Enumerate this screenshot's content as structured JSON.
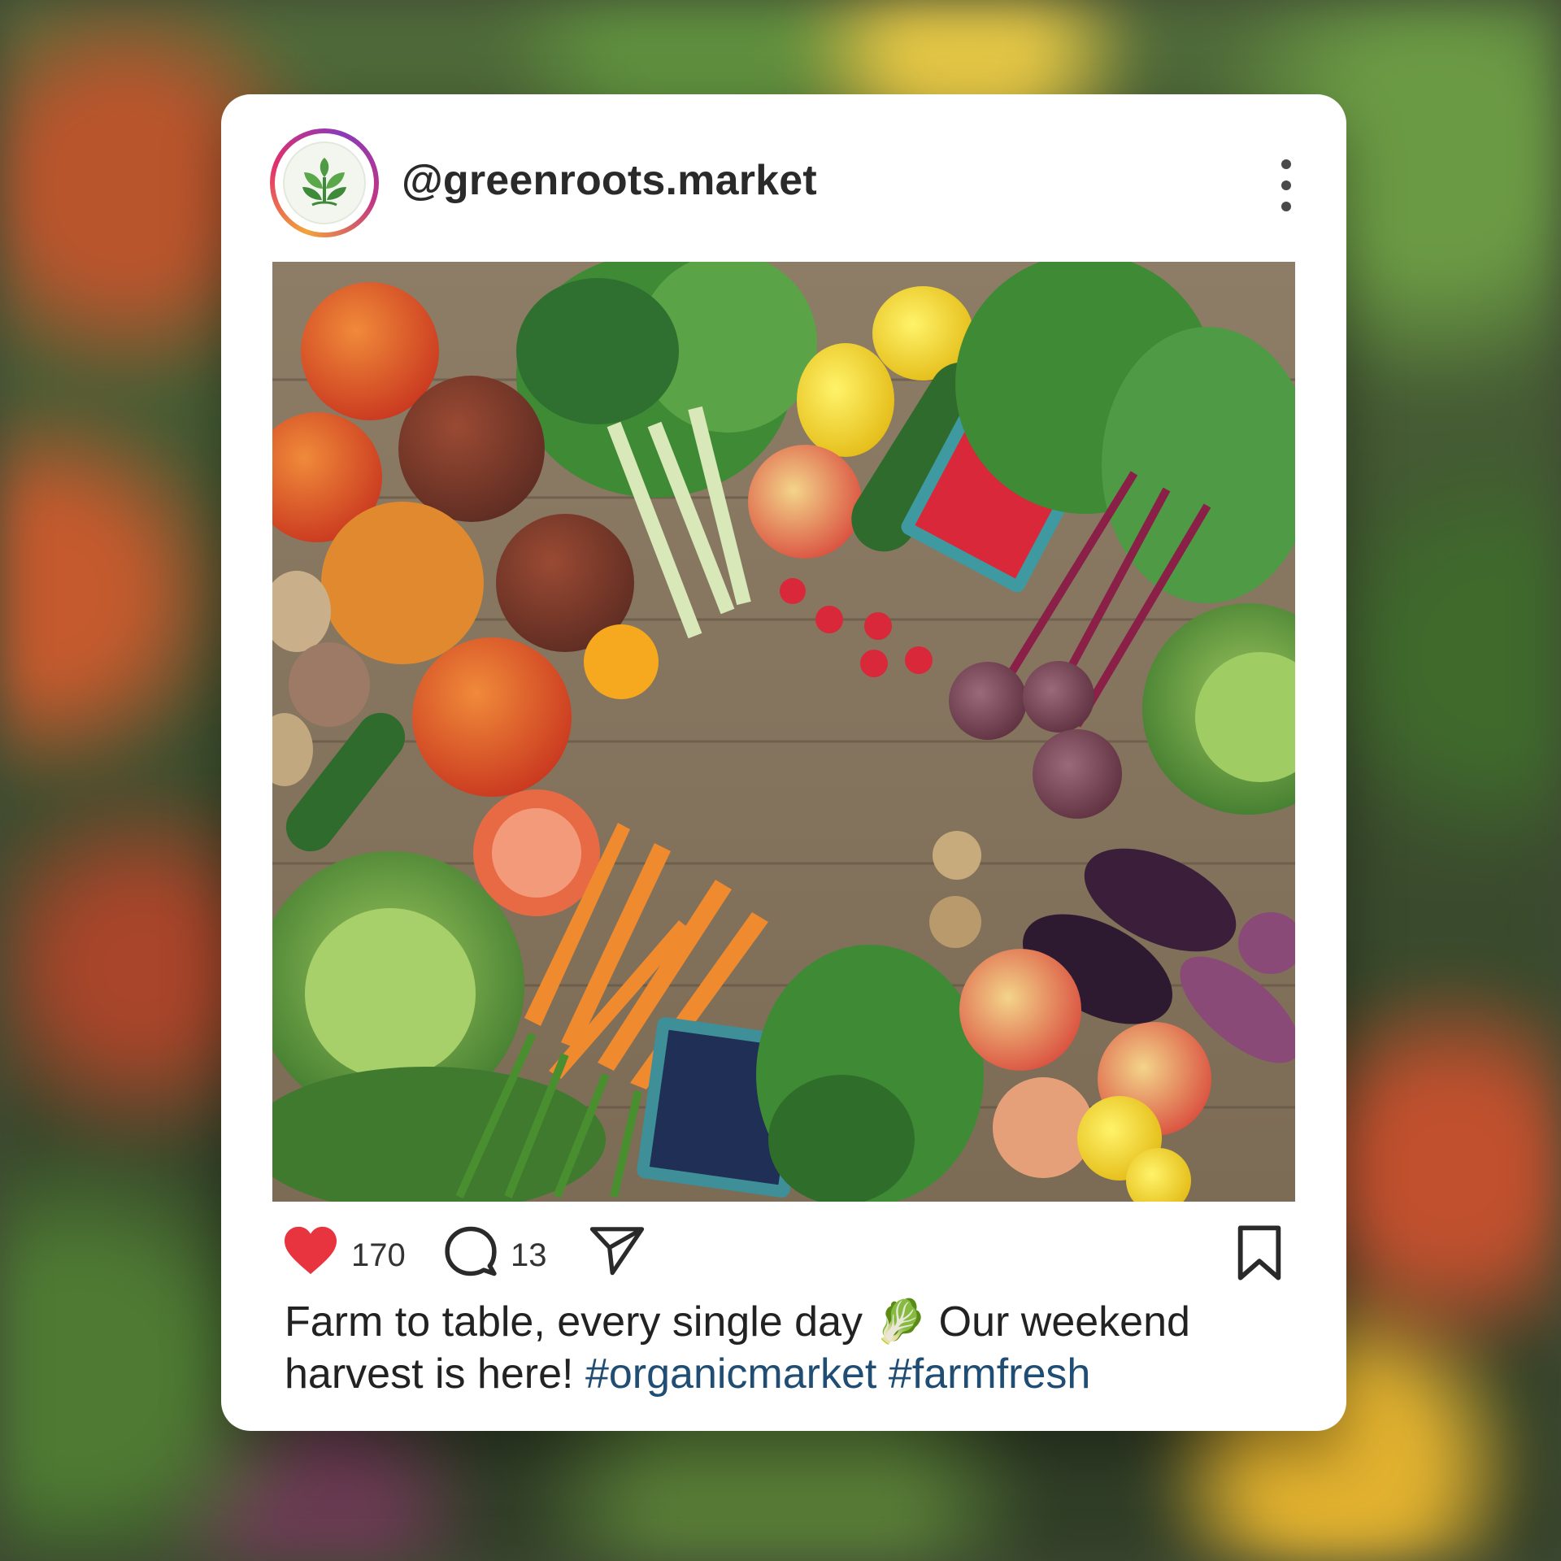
{
  "post": {
    "username": "@greenroots.market",
    "likes": "170",
    "comments": "13",
    "caption_text_1": "Farm to table, every single day ",
    "caption_emoji": "🥬",
    "caption_text_2": " Our weekend harvest is here! ",
    "hashtags": [
      "#organicmarket",
      "#farmfresh"
    ]
  },
  "icons": {
    "avatar": "sprout-logo-icon",
    "menu": "more-vertical-icon",
    "like": "heart-icon",
    "comment": "comment-icon",
    "share": "send-icon",
    "save": "bookmark-icon"
  },
  "colors": {
    "like": "#e8343e",
    "hashtag": "#1f4d73",
    "brand_green": "#3f8a3a"
  }
}
